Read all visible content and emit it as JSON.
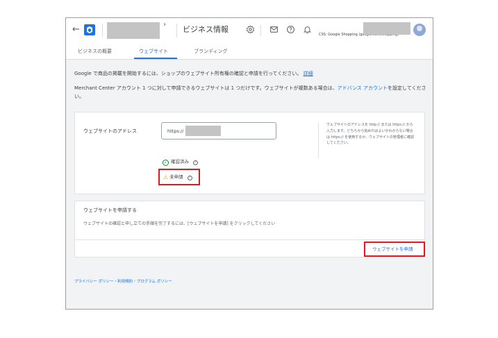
{
  "header": {
    "back_glyph": "←",
    "title": "ビジネス情報",
    "account_caret": "›",
    "css_label": "CSS: Google Shopping (google.com/shopping)",
    "icons": [
      "back-arrow-icon",
      "merchant-center-logo",
      "settings-icon",
      "mail-icon",
      "help-icon",
      "notifications-icon",
      "avatar"
    ]
  },
  "tabs": [
    {
      "label": "ビジネスの概要",
      "active": false
    },
    {
      "label": "ウェブサイト",
      "active": true
    },
    {
      "label": "ブランディング",
      "active": false
    }
  ],
  "intro": {
    "line1": "Google で商品の掲載を開始するには、ショップのウェブサイト所有権の確認と申請を行ってください。",
    "line1_link": "詳細",
    "line2_prefix": "Merchant Center アカウント 1 つに対して申請できるウェブサイトは 1 つだけです。ウェブサイトが複数ある場合は、",
    "line2_link": "アドバンス アカウント",
    "line2_suffix": "を設定してください。"
  },
  "website_card": {
    "label": "ウェブサイトのアドレス",
    "url_prefix": "https://",
    "help_text": "ウェブサイトのアドレスを http:// または https:// から入力します。どちらから始めればよいかわからない場合は https:// を使用するか、ウェブサイトの管理者に確認してください。",
    "status_verified": "確認済み",
    "status_unclaimed": "未申請"
  },
  "claim_card": {
    "title": "ウェブサイトを申請する",
    "description": "ウェブサイトの確認と申し立ての手順を完了するには、[ウェブサイトを申請] をクリックしてください",
    "button_label": "ウェブサイトを申請"
  },
  "footer": {
    "privacy": "プライバシー ポリシー",
    "terms": "利用規約",
    "program": "プログラム ポリシー",
    "separator": "・"
  },
  "colors": {
    "accent": "#1a73e8",
    "highlight_border": "#e0191e",
    "verified": "#188038",
    "warning": "#e8a600"
  }
}
